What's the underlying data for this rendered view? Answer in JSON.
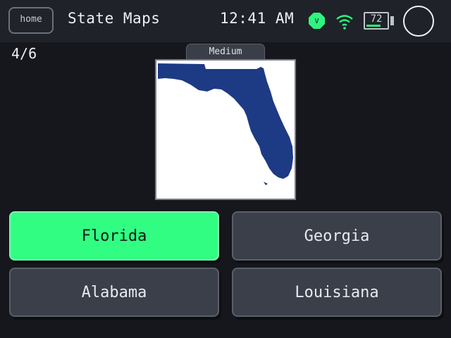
{
  "header": {
    "home_label": "home",
    "title": "State Maps",
    "time": "12:41 AM",
    "vpn_badge": "V",
    "battery_percent": "72",
    "icons": [
      "vpn-icon",
      "wifi-icon",
      "battery-icon",
      "circle-button"
    ]
  },
  "quiz": {
    "progress": "4/6",
    "difficulty": "Medium",
    "map_state": "Florida",
    "answers": [
      "Florida",
      "Georgia",
      "Alabama",
      "Louisiana"
    ],
    "selected_answer": "Florida",
    "selected_state": "correct"
  },
  "colors": {
    "background": "#15171c",
    "topbar": "#1f2228",
    "answer_button": "#3b3f4a",
    "correct": "#31fd83",
    "map_fill": "#1d3a84",
    "accent_green": "#2ef57f"
  }
}
